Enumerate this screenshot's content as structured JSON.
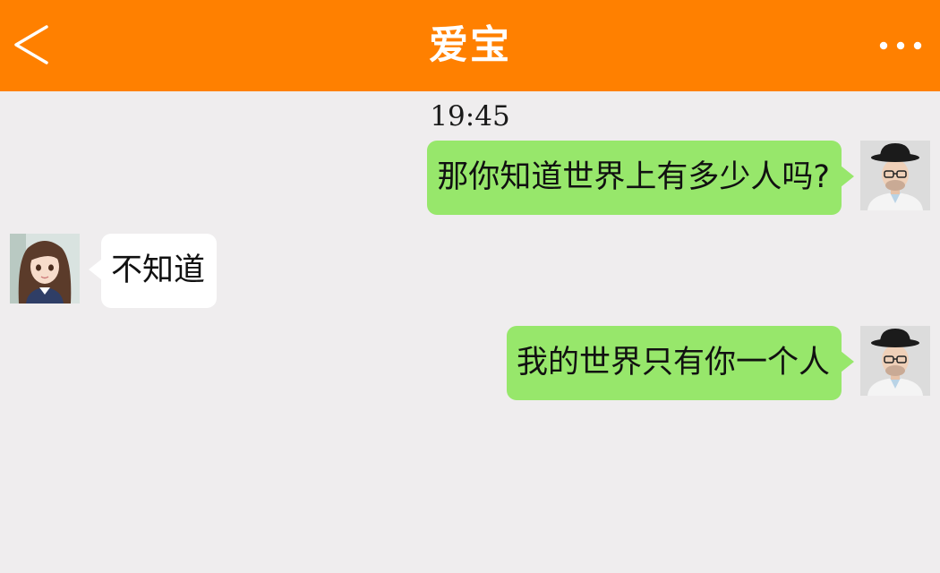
{
  "header": {
    "title": "爱宝",
    "back_icon": "chevron-left-icon",
    "more_icon": "more-dots-icon",
    "color": "#ff8000"
  },
  "timestamp": "19:45",
  "messages": [
    {
      "direction": "sent",
      "text": "那你知道世界上有多少人吗?"
    },
    {
      "direction": "received",
      "text": "不知道"
    },
    {
      "direction": "sent",
      "text": "我的世界只有你一个人"
    }
  ],
  "colors": {
    "sent_bubble": "#97e76b",
    "received_bubble": "#ffffff",
    "background": "#efedee"
  }
}
